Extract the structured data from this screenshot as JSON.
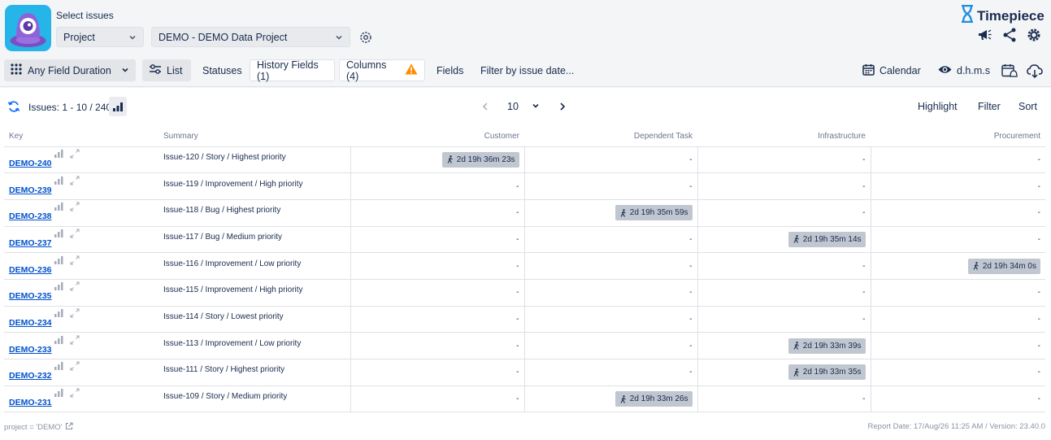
{
  "header": {
    "select_label": "Select issues",
    "project_dropdown": "Project",
    "project_value": "DEMO - DEMO Data Project",
    "brand": "Timepiece"
  },
  "toolbar": {
    "view_mode": "Any Field Duration",
    "list": "List",
    "statuses": "Statuses",
    "history_fields": "History Fields (1)",
    "columns": "Columns (4)",
    "fields": "Fields",
    "filter_by_date": "Filter by issue date...",
    "calendar": "Calendar",
    "format": "d.h.m.s"
  },
  "issues_bar": {
    "count": "Issues: 1 - 10 / 240",
    "page_size": "10",
    "highlight": "Highlight",
    "filter": "Filter",
    "sort": "Sort"
  },
  "table": {
    "headers": [
      "Key",
      "Summary",
      "Customer",
      "Dependent Task",
      "Infrastructure",
      "Procurement"
    ],
    "rows": [
      {
        "key": "DEMO-240",
        "summary": "Issue-120 / Story / Highest priority",
        "cells": [
          "2d 19h 36m 23s",
          "-",
          "-",
          "-"
        ]
      },
      {
        "key": "DEMO-239",
        "summary": "Issue-119 / Improvement / High priority",
        "cells": [
          "-",
          "-",
          "-",
          "-"
        ]
      },
      {
        "key": "DEMO-238",
        "summary": "Issue-118 / Bug / Highest priority",
        "cells": [
          "-",
          "2d 19h 35m 59s",
          "-",
          "-"
        ]
      },
      {
        "key": "DEMO-237",
        "summary": "Issue-117 / Bug / Medium priority",
        "cells": [
          "-",
          "-",
          "2d 19h 35m 14s",
          "-"
        ]
      },
      {
        "key": "DEMO-236",
        "summary": "Issue-116 / Improvement / Low priority",
        "cells": [
          "-",
          "-",
          "-",
          "2d 19h 34m 0s"
        ]
      },
      {
        "key": "DEMO-235",
        "summary": "Issue-115 / Improvement / High priority",
        "cells": [
          "-",
          "-",
          "-",
          "-"
        ]
      },
      {
        "key": "DEMO-234",
        "summary": "Issue-114 / Story / Lowest priority",
        "cells": [
          "-",
          "-",
          "-",
          "-"
        ]
      },
      {
        "key": "DEMO-233",
        "summary": "Issue-113 / Improvement / Low priority",
        "cells": [
          "-",
          "-",
          "2d 19h 33m 39s",
          "-"
        ]
      },
      {
        "key": "DEMO-232",
        "summary": "Issue-111 / Story / Highest priority",
        "cells": [
          "-",
          "-",
          "2d 19h 33m 35s",
          "-"
        ]
      },
      {
        "key": "DEMO-231",
        "summary": "Issue-109 / Story / Medium priority",
        "cells": [
          "-",
          "2d 19h 33m 26s",
          "-",
          "-"
        ]
      }
    ]
  },
  "footer": {
    "query": "project = 'DEMO'",
    "report": "Report Date: 17/Aug/26 11:25 AM / Version: 23.40.0"
  },
  "colors": {
    "logo_bg": "#26b5e8",
    "link": "#0052cc",
    "badge_bg": "#c1c7d0",
    "warning": "#ff8b00"
  }
}
